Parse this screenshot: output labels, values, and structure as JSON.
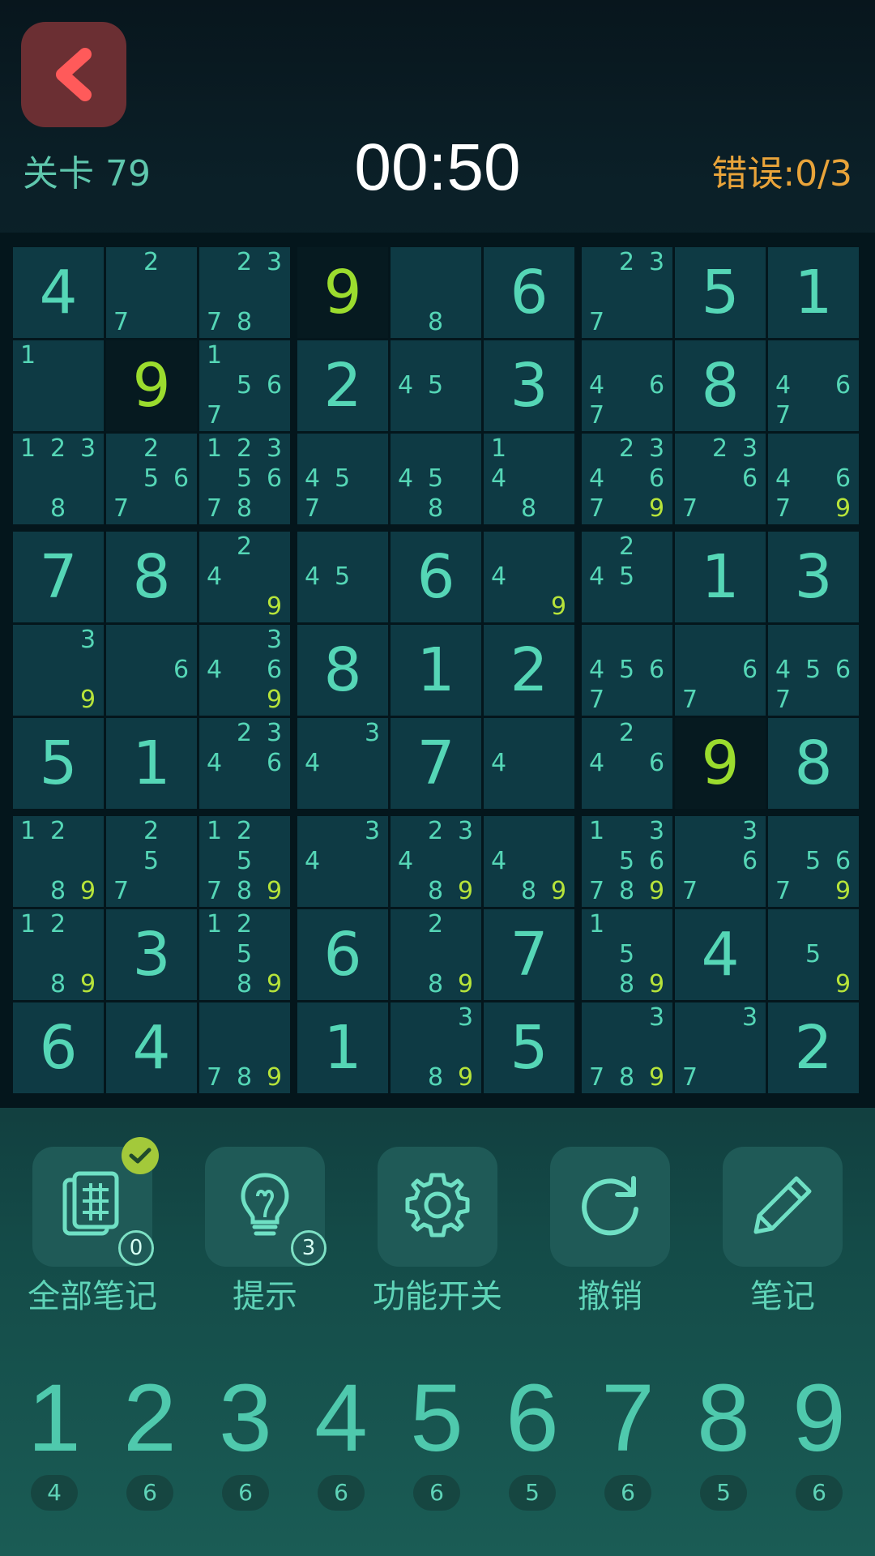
{
  "header": {
    "back_icon": "chevron-left-icon",
    "level_label": "关卡 79",
    "timer": "00:50",
    "errors_label": "错误:0/3"
  },
  "colors": {
    "digit": "#55d6b6",
    "highlight": "#9bdc2e",
    "error_text": "#e9a43a",
    "back_button": "#6b2f33"
  },
  "grid": [
    [
      {
        "v": "4"
      },
      {
        "n": [
          "2",
          "7"
        ]
      },
      {
        "n": [
          "2",
          "3",
          "7",
          "8"
        ]
      },
      {
        "v": "9",
        "hl": true,
        "dark": true
      },
      {
        "n": [
          "8"
        ]
      },
      {
        "v": "6"
      },
      {
        "n": [
          "2",
          "3",
          "7"
        ]
      },
      {
        "v": "5"
      },
      {
        "v": "1"
      }
    ],
    [
      {
        "n": [
          "1"
        ]
      },
      {
        "v": "9",
        "hl": true,
        "dark": true
      },
      {
        "n": [
          "1",
          "5",
          "6",
          "7"
        ]
      },
      {
        "v": "2"
      },
      {
        "n": [
          "4",
          "5"
        ]
      },
      {
        "v": "3"
      },
      {
        "n": [
          "4",
          "6",
          "7"
        ]
      },
      {
        "v": "8"
      },
      {
        "n": [
          "4",
          "6",
          "7"
        ]
      }
    ],
    [
      {
        "n": [
          "1",
          "2",
          "3",
          "8"
        ]
      },
      {
        "n": [
          "2",
          "5",
          "6",
          "7"
        ]
      },
      {
        "n": [
          "1",
          "2",
          "3",
          "5",
          "6",
          "7",
          "8"
        ]
      },
      {
        "n": [
          "4",
          "5",
          "7"
        ]
      },
      {
        "n": [
          "4",
          "5",
          "8"
        ]
      },
      {
        "n": [
          "1",
          "4",
          "8"
        ]
      },
      {
        "n": [
          "2",
          "3",
          "4",
          "6",
          "7",
          "9"
        ]
      },
      {
        "n": [
          "2",
          "3",
          "6",
          "7"
        ]
      },
      {
        "n": [
          "4",
          "6",
          "7",
          "9"
        ]
      }
    ],
    [
      {
        "v": "7"
      },
      {
        "v": "8"
      },
      {
        "n": [
          "2",
          "4",
          "9"
        ]
      },
      {
        "n": [
          "4",
          "5"
        ]
      },
      {
        "v": "6"
      },
      {
        "n": [
          "4",
          "9"
        ]
      },
      {
        "n": [
          "2",
          "4",
          "5"
        ]
      },
      {
        "v": "1"
      },
      {
        "v": "3"
      }
    ],
    [
      {
        "n": [
          "3",
          "9"
        ]
      },
      {
        "n": [
          "6"
        ]
      },
      {
        "n": [
          "3",
          "4",
          "6",
          "9"
        ]
      },
      {
        "v": "8"
      },
      {
        "v": "1"
      },
      {
        "v": "2"
      },
      {
        "n": [
          "4",
          "5",
          "6",
          "7"
        ]
      },
      {
        "n": [
          "6",
          "7"
        ]
      },
      {
        "n": [
          "4",
          "5",
          "6",
          "7"
        ]
      }
    ],
    [
      {
        "v": "5"
      },
      {
        "v": "1"
      },
      {
        "n": [
          "2",
          "3",
          "4",
          "6"
        ]
      },
      {
        "n": [
          "3",
          "4"
        ]
      },
      {
        "v": "7"
      },
      {
        "n": [
          "4"
        ]
      },
      {
        "n": [
          "2",
          "4",
          "6"
        ]
      },
      {
        "v": "9",
        "hl": true,
        "dark": true
      },
      {
        "v": "8"
      }
    ],
    [
      {
        "n": [
          "1",
          "2",
          "8",
          "9"
        ]
      },
      {
        "n": [
          "2",
          "5",
          "7"
        ]
      },
      {
        "n": [
          "1",
          "2",
          "5",
          "7",
          "8",
          "9"
        ]
      },
      {
        "n": [
          "3",
          "4"
        ]
      },
      {
        "n": [
          "2",
          "3",
          "4",
          "8",
          "9"
        ]
      },
      {
        "n": [
          "4",
          "8",
          "9"
        ]
      },
      {
        "n": [
          "1",
          "3",
          "5",
          "6",
          "7",
          "8",
          "9"
        ]
      },
      {
        "n": [
          "3",
          "6",
          "7"
        ]
      },
      {
        "n": [
          "5",
          "6",
          "7",
          "9"
        ]
      }
    ],
    [
      {
        "n": [
          "1",
          "2",
          "8",
          "9"
        ]
      },
      {
        "v": "3"
      },
      {
        "n": [
          "1",
          "2",
          "5",
          "8",
          "9"
        ]
      },
      {
        "v": "6"
      },
      {
        "n": [
          "2",
          "8",
          "9"
        ]
      },
      {
        "v": "7"
      },
      {
        "n": [
          "1",
          "5",
          "8",
          "9"
        ]
      },
      {
        "v": "4"
      },
      {
        "n": [
          "5",
          "9"
        ]
      }
    ],
    [
      {
        "v": "6"
      },
      {
        "v": "4"
      },
      {
        "n": [
          "7",
          "8",
          "9"
        ]
      },
      {
        "v": "1"
      },
      {
        "n": [
          "3",
          "8",
          "9"
        ]
      },
      {
        "v": "5"
      },
      {
        "n": [
          "3",
          "7",
          "8",
          "9"
        ]
      },
      {
        "n": [
          "3",
          "7"
        ]
      },
      {
        "v": "2"
      }
    ]
  ],
  "tools": [
    {
      "label": "全部笔记",
      "icon": "all-notes-icon",
      "badge": "0",
      "checked": true
    },
    {
      "label": "提示",
      "icon": "lightbulb-icon",
      "badge": "3"
    },
    {
      "label": "功能开关",
      "icon": "gear-icon"
    },
    {
      "label": "撤销",
      "icon": "undo-icon"
    },
    {
      "label": "笔记",
      "icon": "pencil-icon"
    }
  ],
  "numpad": [
    {
      "digit": "1",
      "count": "4"
    },
    {
      "digit": "2",
      "count": "6"
    },
    {
      "digit": "3",
      "count": "6"
    },
    {
      "digit": "4",
      "count": "6"
    },
    {
      "digit": "5",
      "count": "6"
    },
    {
      "digit": "6",
      "count": "5"
    },
    {
      "digit": "7",
      "count": "6"
    },
    {
      "digit": "8",
      "count": "5"
    },
    {
      "digit": "9",
      "count": "6"
    }
  ]
}
